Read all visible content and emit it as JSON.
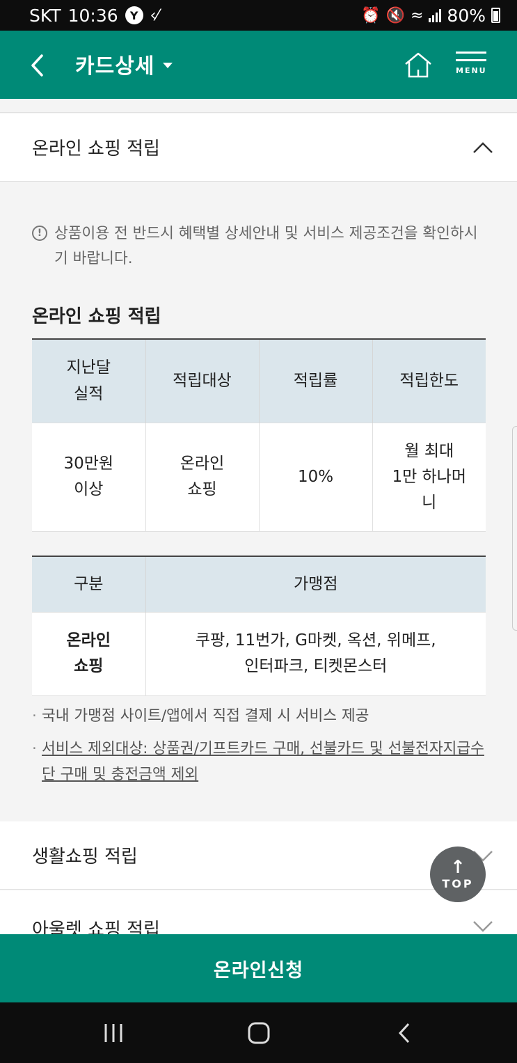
{
  "status_bar": {
    "carrier": "SKT",
    "time": "10:36",
    "battery": "80%",
    "icons": [
      "notification-circle-icon",
      "k-icon",
      "alarm-icon",
      "mute-icon",
      "wifi-icon",
      "signal-icon",
      "battery-icon"
    ]
  },
  "header": {
    "title": "카드상세",
    "menu_label": "MENU",
    "icons": [
      "back-arrow-icon",
      "caret-down-icon",
      "home-icon",
      "menu-icon"
    ]
  },
  "section_open": {
    "title": "온라인 쇼핑 적립",
    "notice": "상품이용 전 반드시 혜택별 상세안내 및 서비스 제공조건을 확인하시기 바랍니다.",
    "sub_title": "온라인 쇼핑 적립",
    "table1": {
      "headers": [
        "지난달\n실적",
        "적립대상",
        "적립률",
        "적립한도"
      ],
      "row": [
        "30만원\n이상",
        "온라인\n쇼핑",
        "10%",
        "월 최대\n1만 하나머\n니"
      ]
    },
    "table2": {
      "headers": [
        "구분",
        "가맹점"
      ],
      "row": [
        "온라인\n쇼핑",
        "쿠팡, 11번가, G마켓, 옥션, 위메프,\n인터파크, 티켓몬스터"
      ]
    },
    "bullets": [
      "국내 가맹점 사이트/앱에서 직접 결제 시 서비스 제공",
      "서비스 제외대상: 상품권/기프트카드 구매, 선불카드 및 선불전자지급수단 구매 및 충전금액 제외"
    ]
  },
  "sections_collapsed": [
    {
      "title": "생활쇼핑 적립"
    },
    {
      "title": "아울렛 쇼핑 적립"
    }
  ],
  "top_button": {
    "label": "TOP"
  },
  "cta": {
    "label": "온라인신청"
  },
  "colors": {
    "brand": "#008a77",
    "table_header_bg": "#dbe6ec",
    "top_button_bg": "#5f6264"
  }
}
